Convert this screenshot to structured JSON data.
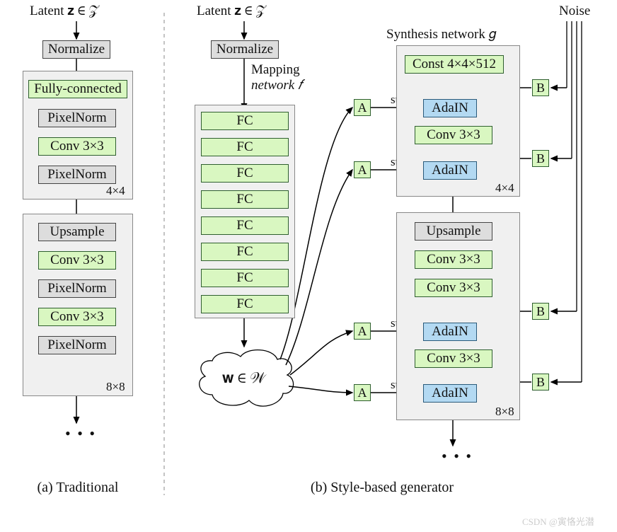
{
  "labels": {
    "latentA": "Latent  𝐳 ∈ 𝒵",
    "latentB": "Latent  𝐳 ∈ 𝒵",
    "noise": "Noise",
    "synth": "Synthesis network  𝑔",
    "mapping1": "Mapping",
    "mapping2": "network  𝑓",
    "wspace": "𝐰 ∈ 𝒲",
    "style": "style",
    "res4": "4×4",
    "res8": "8×8",
    "dots": "• • •",
    "capA": "(a) Traditional",
    "capB": "(b) Style-based generator",
    "wm": "CSDN @寅恪光潜"
  },
  "blocks": {
    "normalize": "Normalize",
    "fcFull": "Fully-connected",
    "pixelnorm": "PixelNorm",
    "conv": "Conv 3×3",
    "upsample": "Upsample",
    "fc": "FC",
    "const": "Const 4×4×512",
    "adain": "AdaIN",
    "A": "A",
    "B": "B"
  }
}
